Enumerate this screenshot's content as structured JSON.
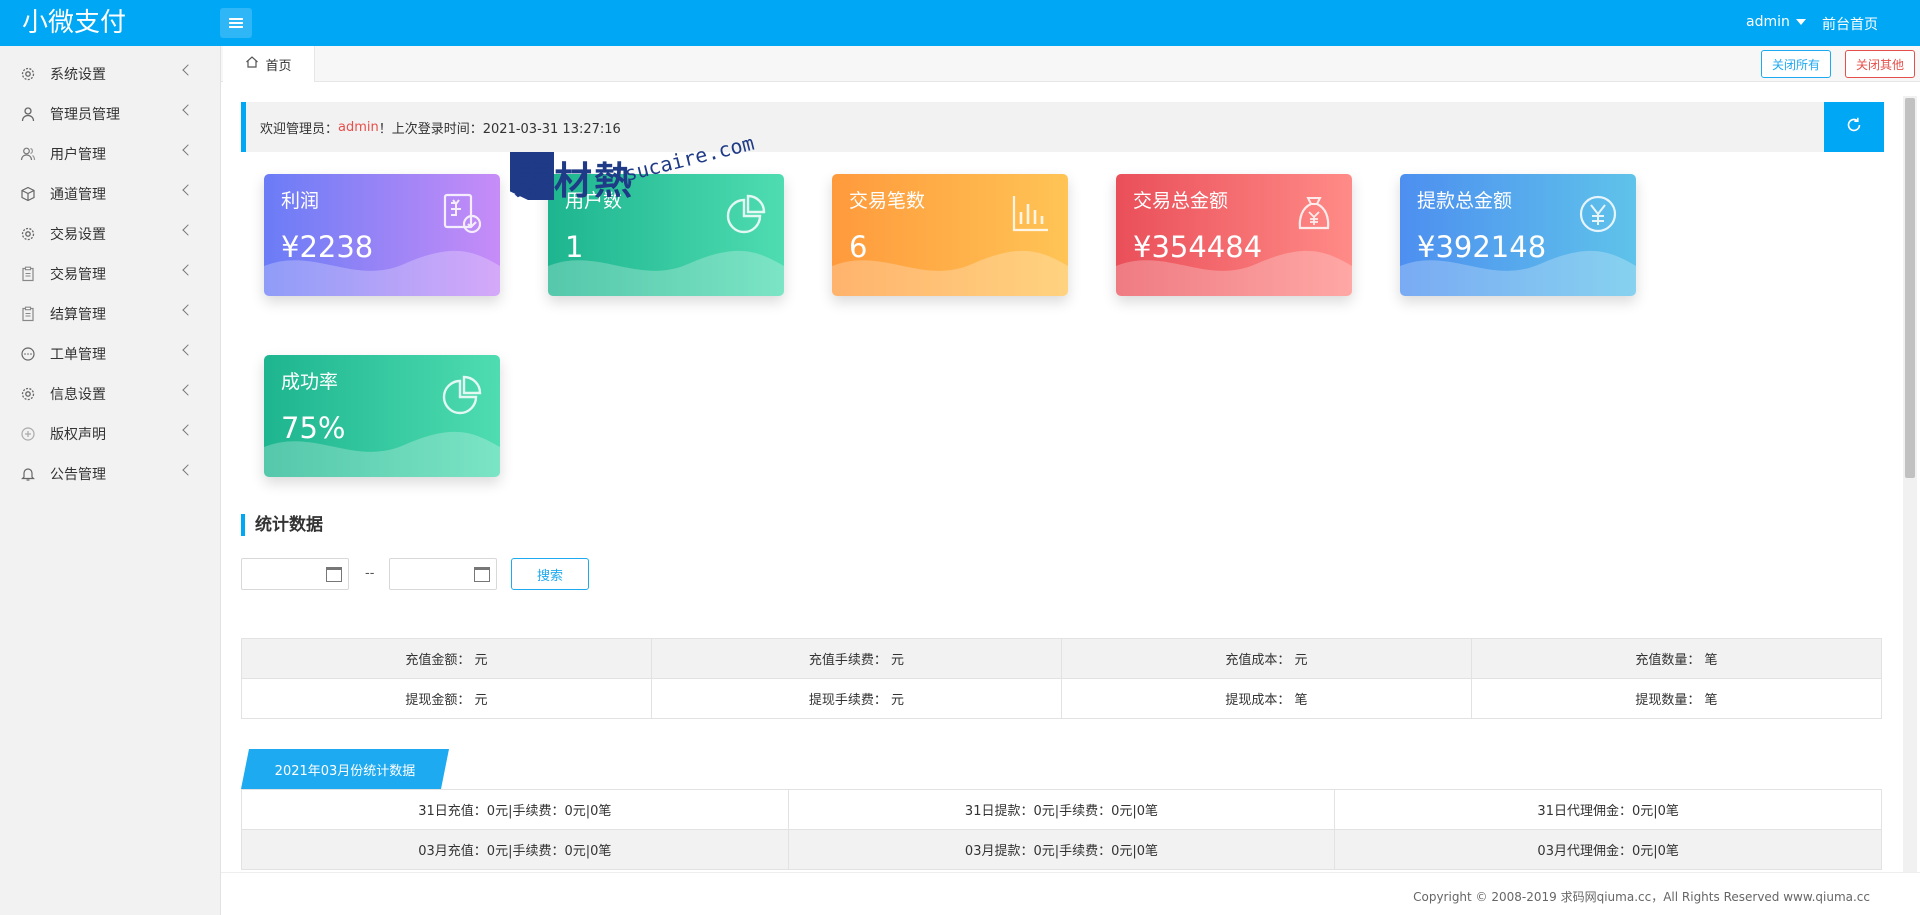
{
  "header": {
    "brand": "小微支付",
    "user": "admin",
    "front_link": "前台首页"
  },
  "sidebar": {
    "items": [
      {
        "label": "系统设置",
        "icon": "gear-icon"
      },
      {
        "label": "管理员管理",
        "icon": "user-icon"
      },
      {
        "label": "用户管理",
        "icon": "users-icon"
      },
      {
        "label": "通道管理",
        "icon": "cube-icon"
      },
      {
        "label": "交易设置",
        "icon": "gear-icon"
      },
      {
        "label": "交易管理",
        "icon": "clipboard-icon"
      },
      {
        "label": "结算管理",
        "icon": "clipboard-icon"
      },
      {
        "label": "工单管理",
        "icon": "chat-icon"
      },
      {
        "label": "信息设置",
        "icon": "gear-icon"
      },
      {
        "label": "版权声明",
        "icon": "plus-circle-icon"
      },
      {
        "label": "公告管理",
        "icon": "bell-icon"
      }
    ]
  },
  "tabs": {
    "home": "首页",
    "close_all": "关闭所有",
    "close_other": "关闭其他"
  },
  "welcome": {
    "prefix": "欢迎管理员：",
    "name": "admin",
    "suffix": "！上次登录时间：2021-03-31 13:27:16"
  },
  "cards": [
    {
      "title": "利润",
      "value": "¥2238",
      "icon": "receipt-check-icon",
      "from": "#6a7cf6",
      "to": "#c78cf7"
    },
    {
      "title": "用户数",
      "value": "1",
      "icon": "pie-chart-icon",
      "from": "#1db58f",
      "to": "#4fdcb1"
    },
    {
      "title": "交易笔数",
      "value": "6",
      "icon": "bar-chart-icon",
      "from": "#ff9a3c",
      "to": "#ffc455"
    },
    {
      "title": "交易总金额",
      "value": "¥354484",
      "icon": "money-bag-icon",
      "from": "#ea4f59",
      "to": "#ff8b87"
    },
    {
      "title": "提款总金额",
      "value": "¥392148",
      "icon": "yen-circle-icon",
      "from": "#4d8ff0",
      "to": "#5fc3ea"
    },
    {
      "title": "成功率",
      "value": "75%",
      "icon": "pie-chart-icon",
      "from": "#1db58f",
      "to": "#4fdcb1"
    }
  ],
  "stats": {
    "title": "统计数据",
    "range_sep": "--",
    "search_label": "搜索",
    "rows": [
      [
        "充值金额： 元",
        "充值手续费： 元",
        "充值成本： 元",
        "充值数量： 笔"
      ],
      [
        "提现金额： 元",
        "提现手续费： 元",
        "提现成本： 笔",
        "提现数量： 笔"
      ]
    ]
  },
  "monthly": {
    "tab": "2021年03月份统计数据",
    "rows": [
      [
        "31日充值：0元|手续费：0元|0笔",
        "31日提款：0元|手续费：0元|0笔",
        "31日代理佣金：0元|0笔"
      ],
      [
        "03月充值：0元|手续费：0元|0笔",
        "03月提款：0元|手续费：0元|0笔",
        "03月代理佣金：0元|0笔"
      ]
    ]
  },
  "footer": "Copyright © 2008-2019 求码网qiuma.cc，All Rights Reserved www.qiuma.cc",
  "watermark": {
    "text": "素材熱",
    "url": "sucaire.com"
  }
}
